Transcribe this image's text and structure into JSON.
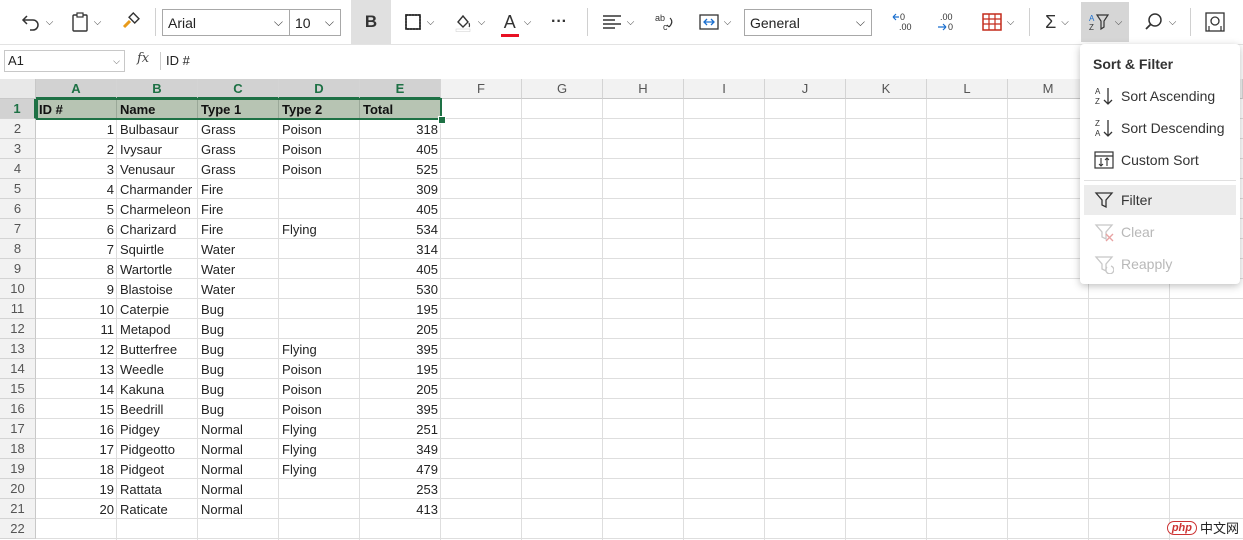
{
  "toolbar": {
    "font_name": "Arial",
    "font_size": "10",
    "bold_label": "B",
    "font_color_label": "A",
    "more_label": "···",
    "number_format": "General",
    "dec_increase_label": "←0\n.00",
    "dec_decrease_label": ".00\n→0",
    "font_color_bar": "#e81123",
    "sort_filter_active_bg": "#d6d6d6"
  },
  "formula_bar": {
    "name_box": "A1",
    "fx_label": "fx",
    "content": "ID #"
  },
  "columns": [
    "A",
    "B",
    "C",
    "D",
    "E",
    "F",
    "G",
    "H",
    "I",
    "J",
    "K",
    "L",
    "M"
  ],
  "rows": [
    "1",
    "2",
    "3",
    "4",
    "5",
    "6",
    "7",
    "8",
    "9",
    "10",
    "11",
    "12",
    "13",
    "14",
    "15",
    "16",
    "17",
    "18",
    "19",
    "20",
    "21",
    "22"
  ],
  "table": {
    "headers": [
      "ID #",
      "Name",
      "Type 1",
      "Type 2",
      "Total"
    ],
    "data": [
      [
        "1",
        "Bulbasaur",
        "Grass",
        "Poison",
        "318"
      ],
      [
        "2",
        "Ivysaur",
        "Grass",
        "Poison",
        "405"
      ],
      [
        "3",
        "Venusaur",
        "Grass",
        "Poison",
        "525"
      ],
      [
        "4",
        "Charmander",
        "Fire",
        "",
        "309"
      ],
      [
        "5",
        "Charmeleon",
        "Fire",
        "",
        "405"
      ],
      [
        "6",
        "Charizard",
        "Fire",
        "Flying",
        "534"
      ],
      [
        "7",
        "Squirtle",
        "Water",
        "",
        "314"
      ],
      [
        "8",
        "Wartortle",
        "Water",
        "",
        "405"
      ],
      [
        "9",
        "Blastoise",
        "Water",
        "",
        "530"
      ],
      [
        "10",
        "Caterpie",
        "Bug",
        "",
        "195"
      ],
      [
        "11",
        "Metapod",
        "Bug",
        "",
        "205"
      ],
      [
        "12",
        "Butterfree",
        "Bug",
        "Flying",
        "395"
      ],
      [
        "13",
        "Weedle",
        "Bug",
        "Poison",
        "195"
      ],
      [
        "14",
        "Kakuna",
        "Bug",
        "Poison",
        "205"
      ],
      [
        "15",
        "Beedrill",
        "Bug",
        "Poison",
        "395"
      ],
      [
        "16",
        "Pidgey",
        "Normal",
        "Flying",
        "251"
      ],
      [
        "17",
        "Pidgeotto",
        "Normal",
        "Flying",
        "349"
      ],
      [
        "18",
        "Pidgeot",
        "Normal",
        "Flying",
        "479"
      ],
      [
        "19",
        "Rattata",
        "Normal",
        "",
        "253"
      ],
      [
        "20",
        "Raticate",
        "Normal",
        "",
        "413"
      ]
    ]
  },
  "sort_filter_menu": {
    "title": "Sort & Filter",
    "items": [
      {
        "label": "Sort Ascending",
        "icon": "sort-ascending-icon",
        "enabled": true
      },
      {
        "label": "Sort Descending",
        "icon": "sort-descending-icon",
        "enabled": true
      },
      {
        "label": "Custom Sort",
        "icon": "custom-sort-icon",
        "enabled": true
      },
      {
        "label": "Filter",
        "icon": "filter-icon",
        "enabled": true
      },
      {
        "label": "Clear",
        "icon": "clear-filter-icon",
        "enabled": false
      },
      {
        "label": "Reapply",
        "icon": "reapply-filter-icon",
        "enabled": false
      }
    ]
  },
  "watermark": {
    "php": "php",
    "site": "中文网"
  },
  "colors": {
    "accent": "#1e7145",
    "header_fill": "#b7c4b3"
  }
}
